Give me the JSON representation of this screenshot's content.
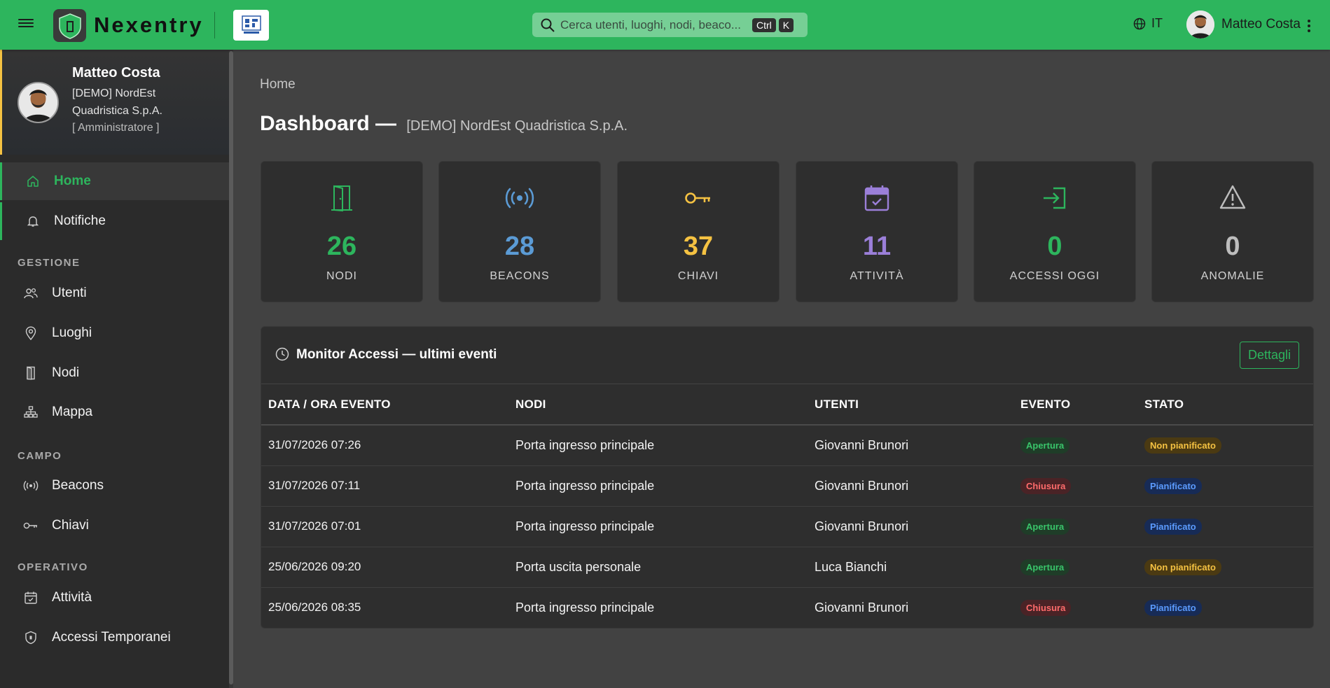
{
  "header": {
    "brand": "Nexentry",
    "search_placeholder": "Cerca utenti, luoghi, nodi, beaco...",
    "kbd_ctrl": "Ctrl",
    "kbd_k": "K",
    "language": "IT",
    "user_name": "Matteo Costa"
  },
  "profile": {
    "name": "Matteo Costa",
    "org": "[DEMO] NordEst Quadristica S.p.A.",
    "role": "[ Amministratore ]"
  },
  "sidebar": {
    "items": [
      {
        "label": "Home",
        "icon": "home-icon"
      },
      {
        "label": "Notifiche",
        "icon": "bell-icon"
      },
      {
        "label": "Utenti",
        "icon": "users-icon"
      },
      {
        "label": "Luoghi",
        "icon": "map-pin-icon"
      },
      {
        "label": "Nodi",
        "icon": "door-icon"
      },
      {
        "label": "Mappa",
        "icon": "sitemap-icon"
      },
      {
        "label": "Beacons",
        "icon": "broadcast-icon"
      },
      {
        "label": "Chiavi",
        "icon": "key-icon"
      },
      {
        "label": "Attività",
        "icon": "calendar-check-icon"
      },
      {
        "label": "Accessi Temporanei",
        "icon": "shield-icon"
      }
    ],
    "sections": [
      "GESTIONE",
      "CAMPO",
      "OPERATIVO"
    ]
  },
  "main": {
    "breadcrumb": "Home",
    "title": "Dashboard —",
    "subtitle": "[DEMO] NordEst Quadristica S.p.A.",
    "stats": [
      {
        "value": "26",
        "label": "NODI",
        "color": "#2db55d",
        "icon": "door-icon"
      },
      {
        "value": "28",
        "label": "BEACONS",
        "color": "#5b9bd5",
        "icon": "broadcast-icon"
      },
      {
        "value": "37",
        "label": "CHIAVI",
        "color": "#f5c242",
        "icon": "key-icon"
      },
      {
        "value": "11",
        "label": "ATTIVITÀ",
        "color": "#9b7fd9",
        "icon": "calendar-check-icon"
      },
      {
        "value": "0",
        "label": "ACCESSI OGGI",
        "color": "#2db55d",
        "icon": "login-icon"
      },
      {
        "value": "0",
        "label": "ANOMALIE",
        "color": "#bdbdbd",
        "icon": "warning-icon"
      }
    ],
    "monitor": {
      "title": "Monitor Accessi — ultimi eventi",
      "details_button": "Dettagli",
      "columns": [
        "DATA / ORA EVENTO",
        "NODI",
        "UTENTI",
        "EVENTO",
        "STATO"
      ],
      "rows": [
        {
          "datetime": "31/07/2026 07:26",
          "node": "Porta ingresso principale",
          "user": "Giovanni Brunori",
          "event": "Apertura",
          "status": "Non pianificato"
        },
        {
          "datetime": "31/07/2026 07:11",
          "node": "Porta ingresso principale",
          "user": "Giovanni Brunori",
          "event": "Chiusura",
          "status": "Pianificato"
        },
        {
          "datetime": "31/07/2026 07:01",
          "node": "Porta ingresso principale",
          "user": "Giovanni Brunori",
          "event": "Apertura",
          "status": "Pianificato"
        },
        {
          "datetime": "25/06/2026 09:20",
          "node": "Porta uscita personale",
          "user": "Luca Bianchi",
          "event": "Apertura",
          "status": "Non pianificato"
        },
        {
          "datetime": "25/06/2026 08:35",
          "node": "Porta ingresso principale",
          "user": "Giovanni Brunori",
          "event": "Chiusura",
          "status": "Pianificato"
        }
      ]
    }
  },
  "colors": {
    "accent": "#2db55d",
    "topbar": "#2db55d",
    "sidebar_bg": "#2b2b2b",
    "main_bg": "#424242"
  }
}
